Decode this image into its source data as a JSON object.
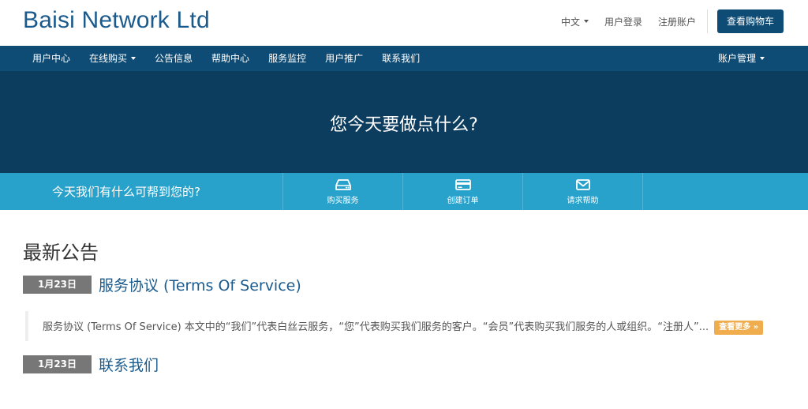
{
  "header": {
    "logo": "Baisi Network Ltd",
    "language": "中文",
    "login": "用户登录",
    "register": "注册账户",
    "cart": "查看购物车"
  },
  "nav": {
    "items": [
      {
        "label": "用户中心"
      },
      {
        "label": "在线购买"
      },
      {
        "label": "公告信息"
      },
      {
        "label": "帮助中心"
      },
      {
        "label": "服务监控"
      },
      {
        "label": "用户推广"
      },
      {
        "label": "联系我们"
      }
    ],
    "account": "账户管理"
  },
  "hero": {
    "title": "您今天要做点什么?"
  },
  "actions": {
    "question": "今天我们有什么可帮到您的?",
    "buy": "购买服务",
    "order": "创建订单",
    "support": "请求帮助"
  },
  "announcements": {
    "title": "最新公告",
    "items": [
      {
        "date": "1月23日",
        "title": "服务协议 (Terms Of Service)",
        "excerpt": "服务协议 (Terms Of Service) 本文中的“我们”代表白丝云服务，“您”代表购买我们服务的客户。“会员”代表购买我们服务的人或组织。“注册人”...",
        "more": "查看更多 »"
      },
      {
        "date": "1月23日",
        "title": "联系我们"
      }
    ]
  },
  "colors": {
    "brand": "#0f4c75",
    "hero": "#0c3c5e",
    "actionbar": "#28a2cb",
    "more": "#f0ad4e"
  }
}
